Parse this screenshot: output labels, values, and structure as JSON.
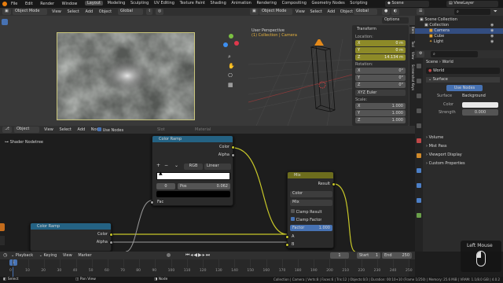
{
  "topbar": {
    "menus": [
      "File",
      "Edit",
      "Render",
      "Window",
      "Help"
    ],
    "workspaces": [
      "Layout",
      "Modeling",
      "Sculpting",
      "UV Editing",
      "Texture Paint",
      "Shading",
      "Animation",
      "Rendering",
      "Compositing",
      "Geometry Nodes",
      "Scripting"
    ],
    "scene": "Scene",
    "view_layer": "ViewLayer"
  },
  "img_editor": {
    "mode": "Object Mode",
    "menus": [
      "View",
      "Select",
      "Add",
      "Object"
    ],
    "orient": "Global"
  },
  "viewport": {
    "mode": "Object Mode",
    "menus": [
      "View",
      "Select",
      "Add",
      "Object"
    ],
    "orient": "Global",
    "options": "Options",
    "perspective": "User Perspective",
    "collection": "(1) Collection | Camera"
  },
  "transform": {
    "title": "Transform",
    "location_label": "Location:",
    "loc": [
      [
        "X",
        "0 m"
      ],
      [
        "Y",
        "0 m"
      ],
      [
        "Z",
        "14.134 m"
      ]
    ],
    "rotation_label": "Rotation:",
    "rot": [
      [
        "X",
        "0°"
      ],
      [
        "Y",
        "0°"
      ],
      [
        "Z",
        "0°"
      ]
    ],
    "euler": "XYZ Euler",
    "scale_label": "Scale:",
    "scale": [
      [
        "X",
        "1.000"
      ],
      [
        "Y",
        "1.000"
      ],
      [
        "Z",
        "1.000"
      ]
    ]
  },
  "side_tabs": [
    "Item",
    "Tool",
    "View",
    "Screenshot Keys"
  ],
  "outliner": {
    "root": "Scene Collection",
    "collection": "Collection",
    "items": [
      "Camera",
      "Cube",
      "Light"
    ]
  },
  "props": {
    "scene": "Scene",
    "world_tab": "World",
    "world": "World",
    "surface_title": "Surface",
    "use_nodes": "Use Nodes",
    "surface_label": "Surface",
    "surface_value": "Background",
    "color_label": "Color",
    "strength_label": "Strength",
    "strength_value": "0.000",
    "sections": [
      "Volume",
      "Mist Pass",
      "Viewport Display",
      "Custom Properties"
    ]
  },
  "node_editor": {
    "type": "Object",
    "menus": [
      "View",
      "Select",
      "Add",
      "Node"
    ],
    "use_nodes": "Use Nodes",
    "slot": "Slot",
    "material": "Material",
    "breadcrumb": "Shader Nodetree",
    "ramp1": {
      "title": "Color Ramp",
      "out_color": "Color",
      "out_alpha": "Alpha",
      "mode": "RGB",
      "interp": "Linear",
      "index": "0",
      "pos_label": "Pos",
      "pos_value": "0.062",
      "fac": "Fac"
    },
    "mix": {
      "title": "Mix",
      "result": "Result",
      "type": "Color",
      "blend": "Mix",
      "clamp_result": "Clamp Result",
      "clamp_factor": "Clamp Factor",
      "factor_label": "Factor",
      "factor_value": "1.000",
      "a": "A",
      "b": "B"
    },
    "ramp2": {
      "title": "Color Ramp",
      "out_color": "Color",
      "out_alpha": "Alpha"
    }
  },
  "timeline": {
    "menus": [
      "Playback",
      "Keying",
      "View",
      "Marker"
    ],
    "current": "1",
    "start_label": "Start",
    "start": "1",
    "end_label": "End",
    "end": "250",
    "ticks": [
      "0",
      "10",
      "20",
      "30",
      "40",
      "50",
      "60",
      "70",
      "80",
      "90",
      "100",
      "110",
      "120",
      "130",
      "140",
      "150",
      "160",
      "170",
      "180",
      "190",
      "200",
      "210",
      "220",
      "230",
      "240",
      "250"
    ],
    "frame_marker": "1"
  },
  "statusbar": {
    "select": "Select",
    "pan": "Pan View",
    "node": "Node",
    "info": "Collection | Camera | Verts:8 | Faces:6 | Tris:12 | Objects:0/3 | Duration: 00:10+10 (Frame 1/250) | Memory: 25.6 MiB | VRAM: 1.1/8.0 GiB | 4.0.2"
  },
  "overlay": {
    "label": "Left Mouse"
  },
  "colors": {
    "accent": "#4772b3",
    "yellow_field": "#8d8a28",
    "node_header_blue": "#246283",
    "node_header_mix": "#6d6d1d",
    "link": "#c7c729"
  }
}
